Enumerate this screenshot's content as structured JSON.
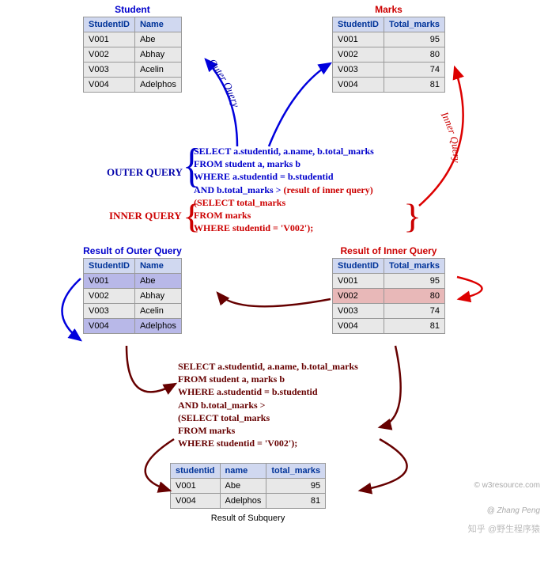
{
  "tables": {
    "student": {
      "title": "Student",
      "headers": [
        "StudentID",
        "Name"
      ],
      "rows": [
        [
          "V001",
          "Abe"
        ],
        [
          "V002",
          "Abhay"
        ],
        [
          "V003",
          "Acelin"
        ],
        [
          "V004",
          "Adelphos"
        ]
      ]
    },
    "marks": {
      "title": "Marks",
      "headers": [
        "StudentID",
        "Total_marks"
      ],
      "rows": [
        [
          "V001",
          "95"
        ],
        [
          "V002",
          "80"
        ],
        [
          "V003",
          "74"
        ],
        [
          "V004",
          "81"
        ]
      ]
    },
    "outer_result": {
      "title": "Result of Outer Query",
      "headers": [
        "StudentID",
        "Name"
      ],
      "rows": [
        [
          "V001",
          "Abe"
        ],
        [
          "V002",
          "Abhay"
        ],
        [
          "V003",
          "Acelin"
        ],
        [
          "V004",
          "Adelphos"
        ]
      ],
      "highlights": [
        0,
        3
      ]
    },
    "inner_result": {
      "title": "Result of Inner Query",
      "headers": [
        "StudentID",
        "Total_marks"
      ],
      "rows": [
        [
          "V001",
          "95"
        ],
        [
          "V002",
          "80"
        ],
        [
          "V003",
          "74"
        ],
        [
          "V004",
          "81"
        ]
      ],
      "highlights": [
        1
      ]
    },
    "final": {
      "title": "Result of Subquery",
      "headers": [
        "studentid",
        "name",
        "total_marks"
      ],
      "rows": [
        [
          "V001",
          "Abe",
          "95"
        ],
        [
          "V004",
          "Adelphos",
          "81"
        ]
      ]
    }
  },
  "labels": {
    "outer_query": "OUTER QUERY",
    "inner_query": "INNER QUERY",
    "outer_arc": "Outer Query",
    "inner_arc": "Inner Query"
  },
  "code": {
    "top": {
      "l1": "SELECT a.studentid, a.name, b.total_marks",
      "l2": "FROM student a, marks b",
      "l3": "WHERE a.studentid = b.studentid",
      "l4a": "AND b.total_marks > ",
      "l4b": "(result of inner query)",
      "l5": "(SELECT total_marks",
      "l6": "FROM marks",
      "l7": "WHERE studentid =  'V002');"
    },
    "bottom": {
      "l1": "SELECT a.studentid, a.name, b.total_marks",
      "l2": "FROM student a, marks b",
      "l3": "WHERE a.studentid = b.studentid",
      "l4": "AND b.total_marks >",
      "l5": "(SELECT total_marks",
      "l6": "FROM marks",
      "l7": "WHERE studentid =  'V002');"
    }
  },
  "footer": {
    "source": "© w3resource.com",
    "zhihu": "知乎 @野生程序猿",
    "author": "@ Zhang Peng"
  }
}
